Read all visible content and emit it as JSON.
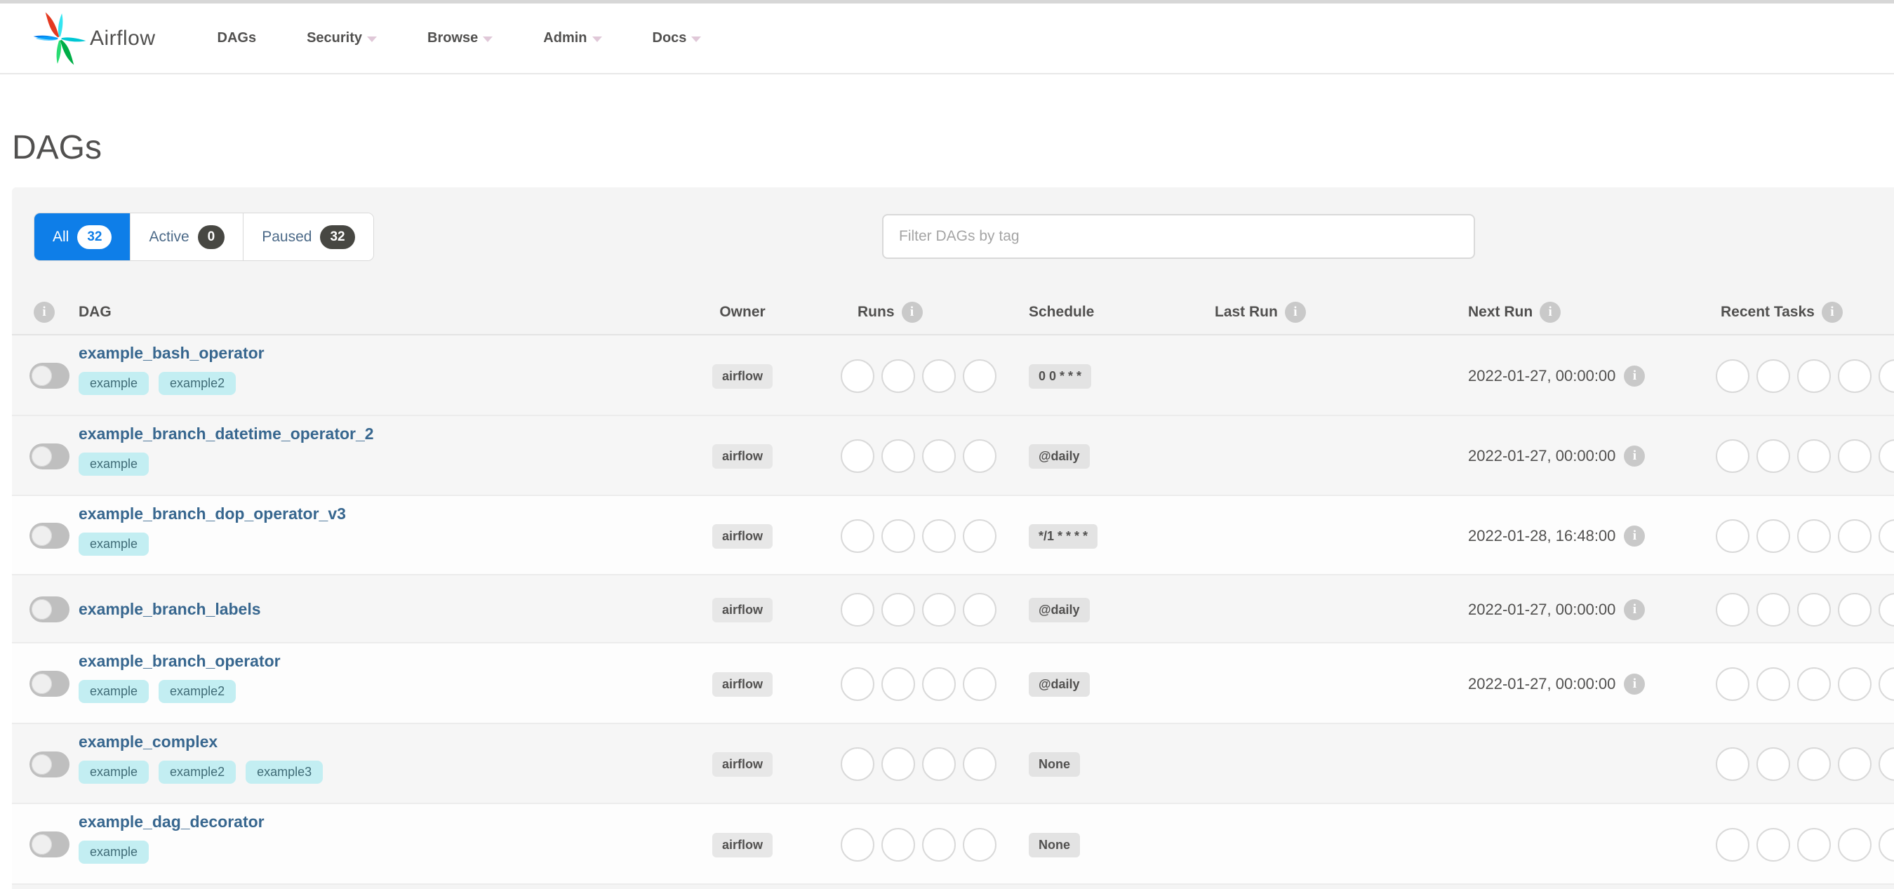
{
  "navbar": {
    "brand": "Airflow",
    "items": [
      {
        "label": "DAGs",
        "caret": false
      },
      {
        "label": "Security",
        "caret": true
      },
      {
        "label": "Browse",
        "caret": true
      },
      {
        "label": "Admin",
        "caret": true
      },
      {
        "label": "Docs",
        "caret": true
      }
    ]
  },
  "page": {
    "title": "DAGs"
  },
  "tabs": [
    {
      "label": "All",
      "count": "32",
      "active": true
    },
    {
      "label": "Active",
      "count": "0",
      "active": false
    },
    {
      "label": "Paused",
      "count": "32",
      "active": false
    }
  ],
  "filter": {
    "placeholder": "Filter DAGs by tag"
  },
  "table": {
    "columns": {
      "dag": "DAG",
      "owner": "Owner",
      "runs": "Runs",
      "schedule": "Schedule",
      "last_run": "Last Run",
      "next_run": "Next Run",
      "recent_tasks": "Recent Tasks"
    },
    "runs_slots": 4,
    "recent_slots": 5,
    "rows": [
      {
        "name": "example_bash_operator",
        "tags": [
          "example",
          "example2"
        ],
        "owner": "airflow",
        "schedule": "0 0 * * *",
        "last_run": "",
        "next_run": "2022-01-27, 00:00:00",
        "paused": true,
        "height": 115,
        "shade": true
      },
      {
        "name": "example_branch_datetime_operator_2",
        "tags": [
          "example"
        ],
        "owner": "airflow",
        "schedule": "@daily",
        "last_run": "",
        "next_run": "2022-01-27, 00:00:00",
        "paused": true,
        "height": 114,
        "shade": true
      },
      {
        "name": "example_branch_dop_operator_v3",
        "tags": [
          "example"
        ],
        "owner": "airflow",
        "schedule": "*/1 * * * *",
        "last_run": "",
        "next_run": "2022-01-28, 16:48:00",
        "paused": true,
        "height": 113,
        "shade": false
      },
      {
        "name": "example_branch_labels",
        "tags": [],
        "owner": "airflow",
        "schedule": "@daily",
        "last_run": "",
        "next_run": "2022-01-27, 00:00:00",
        "paused": true,
        "height": 97,
        "shade": true
      },
      {
        "name": "example_branch_operator",
        "tags": [
          "example",
          "example2"
        ],
        "owner": "airflow",
        "schedule": "@daily",
        "last_run": "",
        "next_run": "2022-01-27, 00:00:00",
        "paused": true,
        "height": 115,
        "shade": false
      },
      {
        "name": "example_complex",
        "tags": [
          "example",
          "example2",
          "example3"
        ],
        "owner": "airflow",
        "schedule": "None",
        "last_run": "",
        "next_run": "",
        "paused": true,
        "height": 114,
        "shade": true
      },
      {
        "name": "example_dag_decorator",
        "tags": [
          "example"
        ],
        "owner": "airflow",
        "schedule": "None",
        "last_run": "",
        "next_run": "",
        "paused": true,
        "height": 115,
        "shade": false
      }
    ]
  },
  "colors": {
    "accent_blue": "#0e7ee8",
    "link_blue": "#38678f",
    "tag_bg": "#c3eef2",
    "logo_red": "#e43921",
    "logo_teal": "#00c7d4",
    "logo_green": "#00ad46",
    "logo_blue": "#017cee"
  }
}
